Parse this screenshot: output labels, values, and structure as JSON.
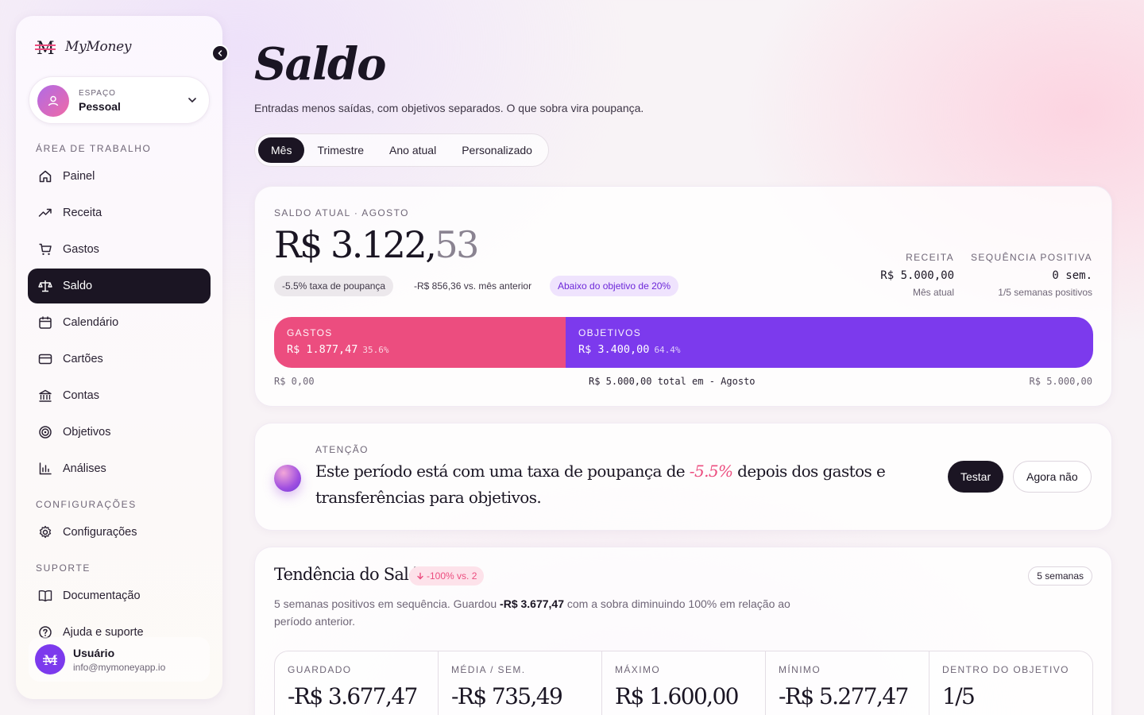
{
  "app": {
    "name": "MyMoney"
  },
  "sidebar": {
    "workspace": {
      "kicker": "ESPAÇO",
      "name": "Pessoal"
    },
    "sections": {
      "work": "ÁREA DE TRABALHO",
      "config": "CONFIGURAÇÕES",
      "support": "SUPORTE"
    },
    "items": [
      {
        "label": "Painel",
        "icon": "home-icon"
      },
      {
        "label": "Receita",
        "icon": "trending-up-icon"
      },
      {
        "label": "Gastos",
        "icon": "cart-icon"
      },
      {
        "label": "Saldo",
        "icon": "scale-icon",
        "active": true
      },
      {
        "label": "Calendário",
        "icon": "calendar-icon"
      },
      {
        "label": "Cartões",
        "icon": "card-icon"
      },
      {
        "label": "Contas",
        "icon": "bank-icon"
      },
      {
        "label": "Objetivos",
        "icon": "target-icon"
      },
      {
        "label": "Análises",
        "icon": "bar-chart-icon"
      },
      {
        "label": "Configurações",
        "icon": "gear-icon"
      },
      {
        "label": "Documentação",
        "icon": "book-icon"
      },
      {
        "label": "Ajuda e suporte",
        "icon": "help-icon"
      }
    ],
    "user": {
      "name": "Usuário",
      "email": "info@mymoneyapp.io"
    }
  },
  "header": {
    "title": "Saldo",
    "subtitle": "Entradas menos saídas, com objetivos separados. O que sobra vira poupança.",
    "tabs": [
      "Mês",
      "Trimestre",
      "Ano atual",
      "Personalizado"
    ],
    "active_tab": "Mês"
  },
  "balance_card": {
    "kicker": "SALDO ATUAL · AGOSTO",
    "amount_main": "R$ 3.122,",
    "amount_cents": "53",
    "pill_savings": "-5.5% taxa de poupança",
    "pill_prev": "-R$ 856,36 vs. mês anterior",
    "pill_goal": "Abaixo do objetivo de 20%",
    "income": {
      "label": "RECEITA",
      "value": "R$ 5.000,00",
      "note": "Mês atual"
    },
    "streak": {
      "label": "SEQUÊNCIA POSITIVA",
      "value": "0 sem.",
      "note": "1/5 semanas positivos"
    },
    "split": {
      "expenses": {
        "label": "GASTOS",
        "amount": "R$ 1.877,47",
        "pct_text": "35.6%",
        "fraction": 0.356
      },
      "goals": {
        "label": "OBJETIVOS",
        "amount": "R$ 3.400,00",
        "pct_text": "64.4%",
        "fraction": 0.644
      }
    },
    "axis": {
      "min": "R$ 0,00",
      "center": "R$ 5.000,00 total em - Agosto",
      "max": "R$ 5.000,00"
    },
    "colors": {
      "expenses": "#ec4d7f",
      "goals": "#7c3aed"
    }
  },
  "alert": {
    "kicker": "ATENÇÃO",
    "text_before": "Este período está com uma taxa de poupança de ",
    "highlight": "-5.5%",
    "text_after": " depois dos gastos e transferências para objetivos.",
    "primary": "Testar",
    "secondary": "Agora não"
  },
  "trend": {
    "title": "Tendência do Saldo",
    "badge": "-100% vs. 2",
    "weeks": "5 semanas",
    "desc_before": "5 semanas positivos em sequência. Guardou ",
    "desc_bold": "-R$ 3.677,47",
    "desc_after": " com a sobra diminuindo 100% em relação ao período anterior.",
    "metrics": [
      {
        "label": "GUARDADO",
        "value": "-R$ 3.677,47"
      },
      {
        "label": "MÉDIA / SEM.",
        "value": "-R$ 735,49"
      },
      {
        "label": "MÁXIMO",
        "value": "R$ 1.600,00"
      },
      {
        "label": "MÍNIMO",
        "value": "-R$ 5.277,47"
      },
      {
        "label": "DENTRO DO OBJETIVO",
        "value": "1/5"
      }
    ]
  }
}
